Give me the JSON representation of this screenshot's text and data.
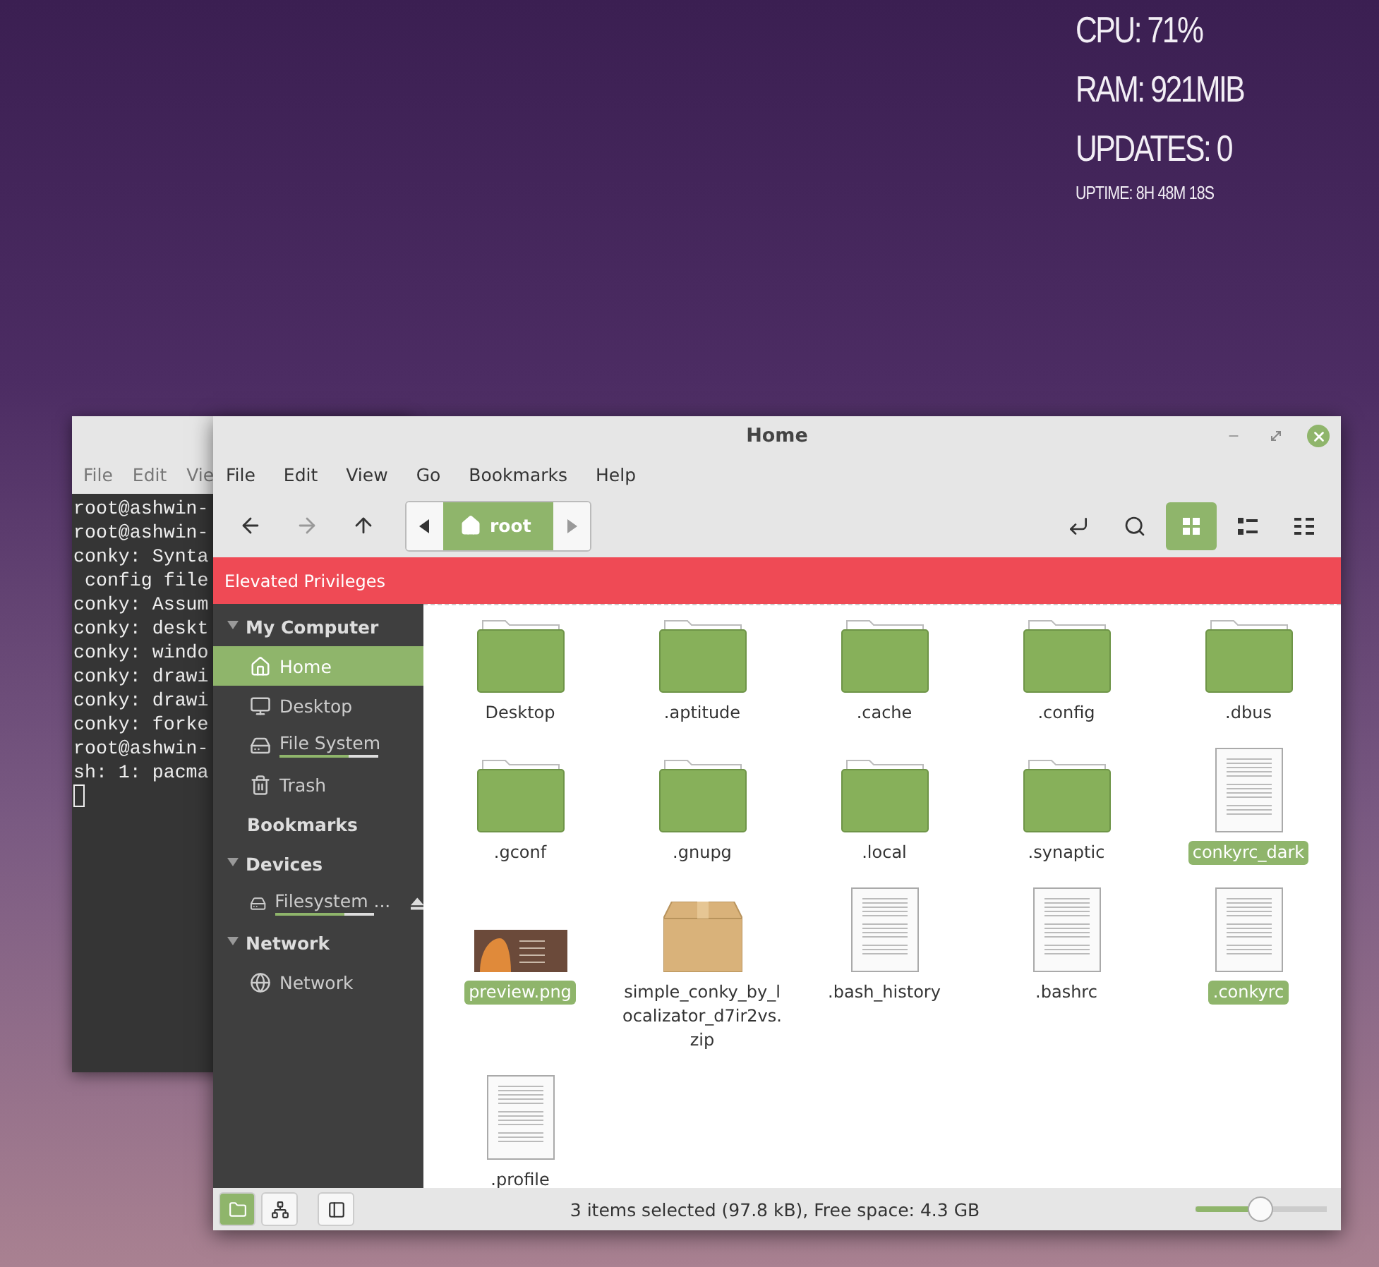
{
  "conky": [
    {
      "text": "CPU: 71%",
      "kind": "large"
    },
    {
      "text": "RAM: 921MIB",
      "kind": "large"
    },
    {
      "text": "UPDATES: 0",
      "kind": "large"
    },
    {
      "text": "UPTIME: 8H 48M 18S",
      "kind": "small"
    }
  ],
  "terminal": {
    "menu": [
      "File",
      "Edit",
      "Vie"
    ],
    "lines": [
      "root@ashwin-",
      "root@ashwin-",
      "conky: Synta",
      " config file",
      "conky: Assum",
      "conky: deskt",
      "conky: windo",
      "conky: drawi",
      "conky: drawi",
      "conky: forke",
      "root@ashwin-",
      "sh: 1: pacma"
    ]
  },
  "window": {
    "title": "Home"
  },
  "menu": [
    "File",
    "Edit",
    "View",
    "Go",
    "Bookmarks",
    "Help"
  ],
  "toolbar": {
    "back_disabled": false,
    "forward_disabled": true,
    "path": "root",
    "views": [
      {
        "kind": "icons",
        "selected": true
      },
      {
        "kind": "compact",
        "selected": false
      },
      {
        "kind": "list",
        "selected": false
      }
    ]
  },
  "banner": "Elevated Privileges",
  "sidebar": [
    {
      "title": "My Computer",
      "kind": "group",
      "expanded": true,
      "items": [
        {
          "label": "Home",
          "kind": "home",
          "selected": true
        },
        {
          "label": "Desktop",
          "kind": "desktop",
          "selected": false
        },
        {
          "label": "File System",
          "kind": "drive",
          "selected": false,
          "level": 0.7
        },
        {
          "label": "Trash",
          "kind": "trash",
          "selected": false
        }
      ]
    },
    {
      "title": "Bookmarks",
      "kind": "label"
    },
    {
      "title": "Devices",
      "kind": "group",
      "expanded": true,
      "items": [
        {
          "label": "Filesystem ...",
          "kind": "drive",
          "selected": false,
          "level": 0.7,
          "ejectable": true
        }
      ]
    },
    {
      "title": "Network",
      "kind": "group",
      "expanded": true,
      "items": [
        {
          "label": "Network",
          "kind": "network",
          "selected": false
        }
      ]
    }
  ],
  "files": [
    {
      "name": "Desktop",
      "kind": "folder",
      "selected": false
    },
    {
      "name": ".aptitude",
      "kind": "folder",
      "selected": false
    },
    {
      "name": ".cache",
      "kind": "folder",
      "selected": false
    },
    {
      "name": ".config",
      "kind": "folder",
      "selected": false
    },
    {
      "name": ".dbus",
      "kind": "folder",
      "selected": false
    },
    {
      "name": ".gconf",
      "kind": "folder",
      "selected": false
    },
    {
      "name": ".gnupg",
      "kind": "folder",
      "selected": false
    },
    {
      "name": ".local",
      "kind": "folder",
      "selected": false
    },
    {
      "name": ".synaptic",
      "kind": "folder",
      "selected": false
    },
    {
      "name": "conkyrc_dark",
      "kind": "text",
      "selected": true
    },
    {
      "name": "preview.png",
      "kind": "image",
      "selected": true
    },
    {
      "name": "simple_conky_by_localizator_d7ir2vs.zip",
      "kind": "archive",
      "selected": false
    },
    {
      "name": ".bash_history",
      "kind": "text",
      "selected": false
    },
    {
      "name": ".bashrc",
      "kind": "text",
      "selected": false
    },
    {
      "name": ".conkyrc",
      "kind": "text",
      "selected": true
    },
    {
      "name": ".profile",
      "kind": "text",
      "selected": false
    }
  ],
  "status_bar": {
    "text": "3 items selected (97.8 kB), Free space: 4.3 GB",
    "panes": [
      {
        "kind": "places",
        "selected": true
      },
      {
        "kind": "tree",
        "selected": false
      }
    ],
    "zoom": {
      "level": 0.49
    }
  }
}
